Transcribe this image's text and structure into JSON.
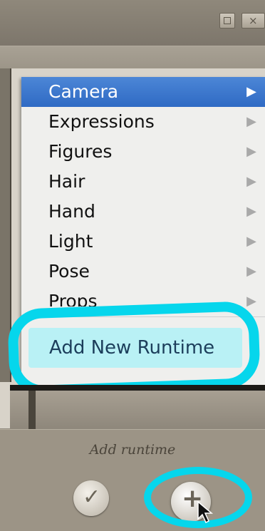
{
  "window": {
    "restore_icon": "restore-icon",
    "close_glyph": "×"
  },
  "menu": {
    "items": [
      {
        "label": "Camera",
        "selected": true
      },
      {
        "label": "Expressions"
      },
      {
        "label": "Figures"
      },
      {
        "label": "Hair"
      },
      {
        "label": "Hand"
      },
      {
        "label": "Light"
      },
      {
        "label": "Pose"
      },
      {
        "label": "Props"
      }
    ],
    "submenu_arrow": "▶",
    "add_new_runtime": "Add New Runtime"
  },
  "footer": {
    "caption": "Add runtime",
    "check_icon": "✓",
    "add_icon": "+"
  },
  "colors": {
    "highlight": "#06d6ec",
    "selection": "#3a73cc"
  }
}
